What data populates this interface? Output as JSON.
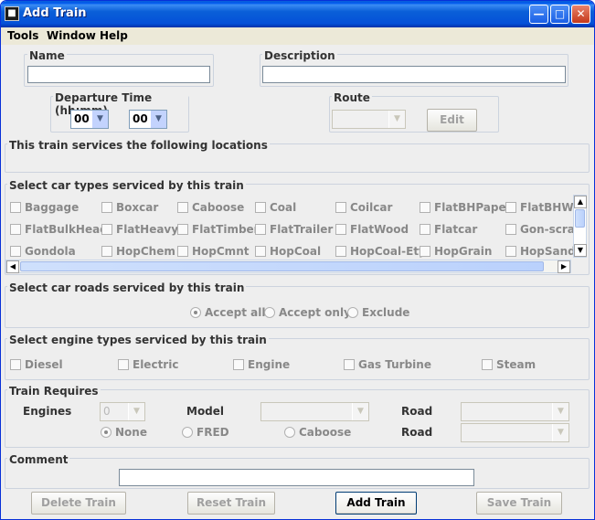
{
  "window": {
    "title": "Add Train"
  },
  "menu": [
    "Tools",
    "Window",
    "Help"
  ],
  "name": {
    "label": "Name",
    "value": ""
  },
  "description": {
    "label": "Description",
    "value": ""
  },
  "departure": {
    "label": "Departure Time (hh:mm)",
    "hour": "00",
    "minute": "00"
  },
  "route": {
    "label": "Route",
    "value": "",
    "edit_label": "Edit"
  },
  "locations": {
    "label": "This train services the following locations"
  },
  "car_types": {
    "label": "Select car types serviced by this train",
    "rows": [
      [
        "Baggage",
        "Boxcar",
        "Caboose",
        "Coal",
        "Coilcar",
        "FlatBHPaper",
        "FlatBHWo"
      ],
      [
        "FlatBulkHead",
        "FlatHeavy",
        "FlatTimber",
        "FlatTrailer",
        "FlatWood",
        "Flatcar",
        "Gon-scrap"
      ],
      [
        "Gondola",
        "HopChem",
        "HopCmnt",
        "HopCoal",
        "HopCoal-Ety",
        "HopGrain",
        "HopSand"
      ]
    ]
  },
  "car_roads": {
    "label": "Select car roads serviced by this train",
    "options": [
      "Accept all",
      "Accept only",
      "Exclude"
    ],
    "selected": "Accept all"
  },
  "engine_types": {
    "label": "Select engine types serviced by this train",
    "items": [
      "Diesel",
      "Electric",
      "Engine",
      "Gas Turbine",
      "Steam"
    ]
  },
  "requires": {
    "label": "Train Requires",
    "engines_label": "Engines",
    "engines_value": "0",
    "model_label": "Model",
    "road_label": "Road",
    "road2_label": "Road",
    "caboose_options": [
      "None",
      "FRED",
      "Caboose"
    ],
    "selected": "None"
  },
  "comment": {
    "label": "Comment",
    "value": ""
  },
  "buttons": {
    "delete": "Delete Train",
    "reset": "Reset Train",
    "add": "Add Train",
    "save": "Save Train"
  }
}
